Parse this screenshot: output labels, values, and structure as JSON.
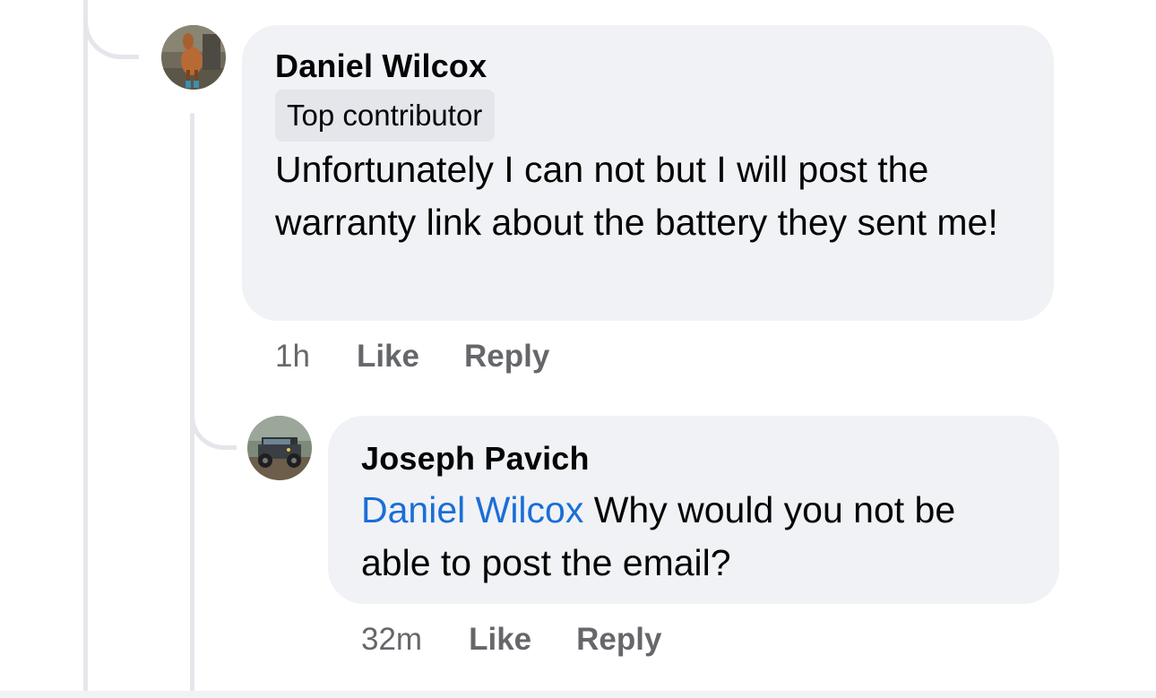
{
  "comments": [
    {
      "author": "Daniel Wilcox",
      "badge": "Top contributor",
      "text": "Unfortunately I can not but I will post the warranty link about the battery they sent me!",
      "time": "1h",
      "like_label": "Like",
      "reply_label": "Reply",
      "avatar_icon": "horse-photo-avatar"
    },
    {
      "author": "Joseph Pavich",
      "mention": "Daniel Wilcox",
      "text": " Why would you not be able to post the email?",
      "time": "32m",
      "like_label": "Like",
      "reply_label": "Reply",
      "avatar_icon": "jeep-photo-avatar"
    }
  ],
  "colors": {
    "bubble": "#f0f2f5",
    "mention": "#1a6ed8",
    "meta": "#65676b",
    "thread_line": "#e4e6eb"
  }
}
